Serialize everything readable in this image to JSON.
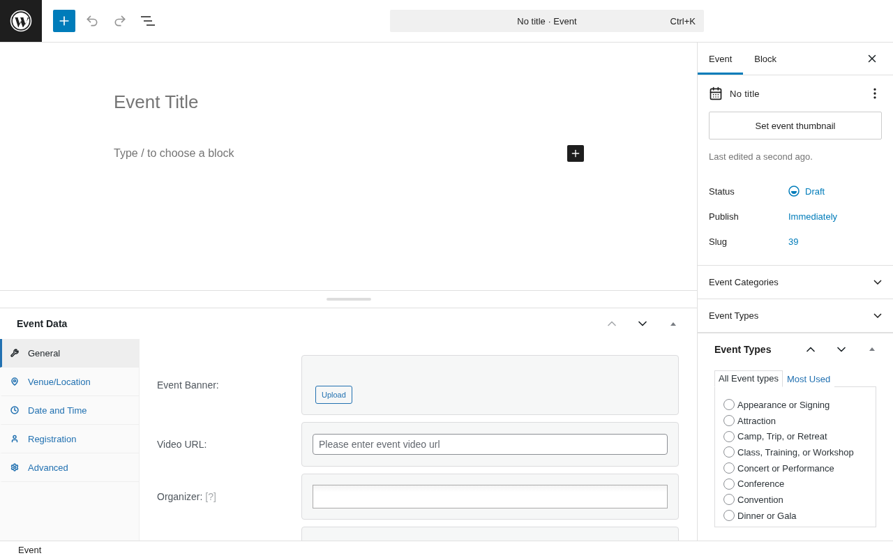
{
  "toolbar": {
    "command_bar": {
      "title": "No title · Event",
      "shortcut": "Ctrl+K"
    }
  },
  "editor": {
    "title_placeholder": "Event Title",
    "block_placeholder": "Type / to choose a block"
  },
  "metabox": {
    "title": "Event Data",
    "tabs": [
      {
        "label": "General",
        "selected": true
      },
      {
        "label": "Venue/Location",
        "selected": false
      },
      {
        "label": "Date and Time",
        "selected": false
      },
      {
        "label": "Registration",
        "selected": false
      },
      {
        "label": "Advanced",
        "selected": false
      }
    ],
    "fields": [
      {
        "kind": "upload",
        "label": "Event Banner:",
        "button": "Upload"
      },
      {
        "kind": "text",
        "label": "Video URL:",
        "placeholder": "Please enter event video url"
      },
      {
        "kind": "select",
        "label": "Organizer:",
        "hint": "[?]"
      },
      {
        "kind": "empty"
      }
    ]
  },
  "sidebar": {
    "tabs": [
      {
        "label": "Event",
        "selected": true
      },
      {
        "label": "Block",
        "selected": false
      }
    ],
    "post_title": "No title",
    "thumbnail_button": "Set event thumbnail",
    "last_edited": "Last edited a second ago.",
    "summary": [
      {
        "kind": "status",
        "label": "Status",
        "value": "Draft"
      },
      {
        "kind": "link",
        "label": "Publish",
        "value": "Immediately"
      },
      {
        "kind": "link",
        "label": "Slug",
        "value": "39"
      }
    ],
    "panels": [
      {
        "title": "Event Categories",
        "expanded": false
      },
      {
        "title": "Event Types",
        "expanded": false
      }
    ],
    "event_types_box": {
      "title": "Event Types",
      "tabs": [
        {
          "label": "All Event types",
          "selected": true
        },
        {
          "label": "Most Used",
          "selected": false
        }
      ],
      "options": [
        {
          "label": "Appearance or Signing",
          "checked": false
        },
        {
          "label": "Attraction",
          "checked": false
        },
        {
          "label": "Camp, Trip, or Retreat",
          "checked": false
        },
        {
          "label": "Class, Training, or Workshop",
          "checked": false
        },
        {
          "label": "Concert or Performance",
          "checked": false
        },
        {
          "label": "Conference",
          "checked": false
        },
        {
          "label": "Convention",
          "checked": false
        },
        {
          "label": "Dinner or Gala",
          "checked": false
        }
      ]
    }
  },
  "footer": {
    "breadcrumb": "Event"
  }
}
